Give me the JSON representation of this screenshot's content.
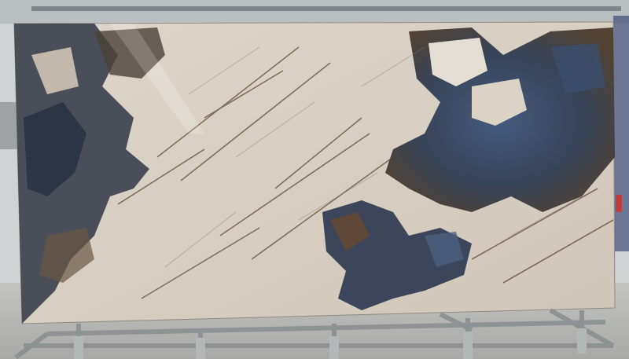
{
  "scene": {
    "subject": "marble slab",
    "colors": {
      "stone_base": "#d9d0c5",
      "vein_dark": "#2f3440",
      "vein_blue": "#3b4f6e",
      "vein_brown": "#6b4a2e",
      "floor": "#b8b8b4",
      "rack": "#8e9294",
      "wall": "#d2d5d6"
    }
  }
}
